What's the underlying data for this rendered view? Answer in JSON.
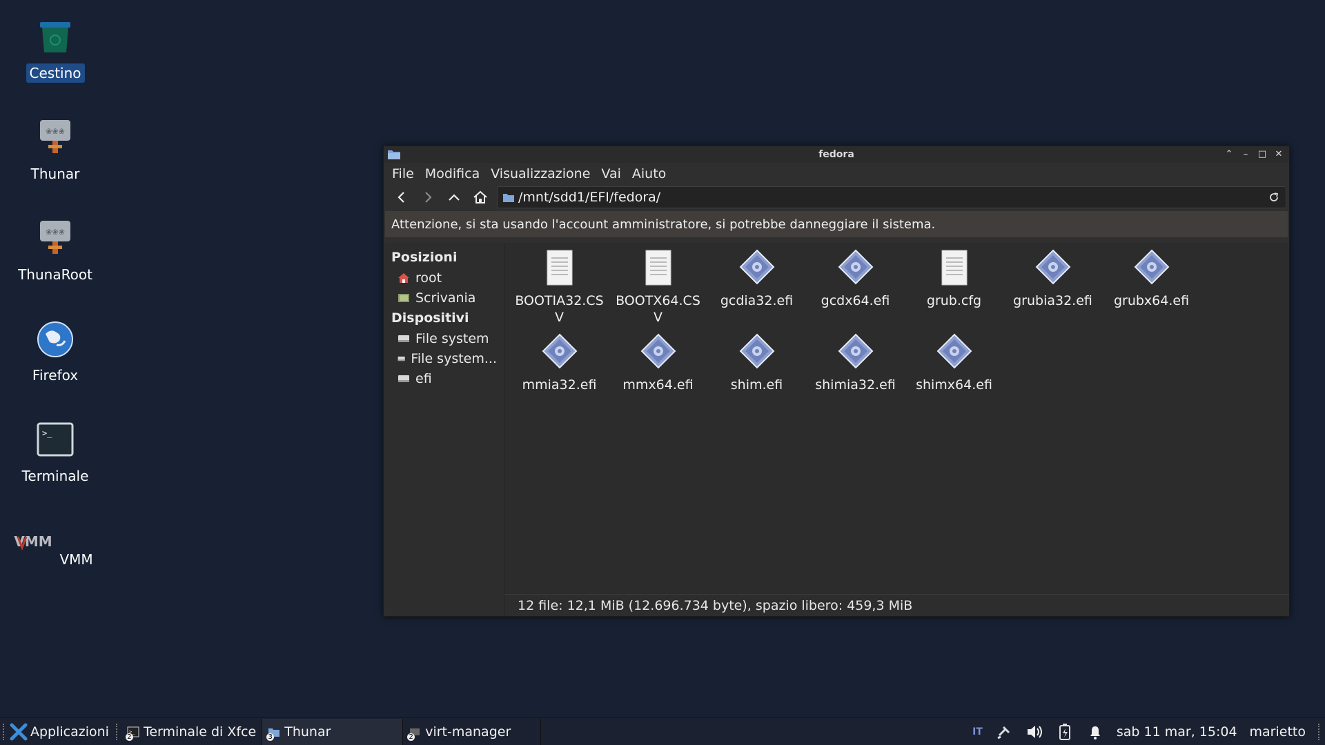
{
  "desktop": {
    "icons": [
      {
        "label": "Cestino",
        "icon": "trash-icon"
      },
      {
        "label": "Thunar",
        "icon": "file-manager-icon"
      },
      {
        "label": "ThunaRoot",
        "icon": "file-manager-root-icon"
      },
      {
        "label": "Firefox",
        "icon": "firefox-icon"
      },
      {
        "label": "Terminale",
        "icon": "terminal-icon"
      },
      {
        "label": "VMM",
        "icon": "vmm-icon"
      }
    ]
  },
  "window": {
    "title": "fedora",
    "menu": [
      "File",
      "Modifica",
      "Visualizzazione",
      "Vai",
      "Aiuto"
    ],
    "path": "/mnt/sdd1/EFI/fedora/",
    "warning": "Attenzione, si sta usando l'account amministratore, si potrebbe danneggiare il sistema.",
    "sidebar": {
      "places_header": "Posizioni",
      "places": [
        {
          "label": "root",
          "icon": "home-icon"
        },
        {
          "label": "Scrivania",
          "icon": "desktop-icon"
        }
      ],
      "devices_header": "Dispositivi",
      "devices": [
        {
          "label": "File system",
          "icon": "drive-icon"
        },
        {
          "label": "File system...",
          "icon": "drive-icon"
        },
        {
          "label": "efi",
          "icon": "drive-icon"
        }
      ]
    },
    "files": [
      {
        "name": "BOOTIA32.CSV",
        "type": "text"
      },
      {
        "name": "BOOTX64.CSV",
        "type": "text"
      },
      {
        "name": "gcdia32.efi",
        "type": "executable"
      },
      {
        "name": "gcdx64.efi",
        "type": "executable"
      },
      {
        "name": "grub.cfg",
        "type": "text"
      },
      {
        "name": "grubia32.efi",
        "type": "executable"
      },
      {
        "name": "grubx64.efi",
        "type": "executable"
      },
      {
        "name": "mmia32.efi",
        "type": "executable"
      },
      {
        "name": "mmx64.efi",
        "type": "executable"
      },
      {
        "name": "shim.efi",
        "type": "executable"
      },
      {
        "name": "shimia32.efi",
        "type": "executable"
      },
      {
        "name": "shimx64.efi",
        "type": "executable"
      }
    ],
    "status": "12 file: 12,1 MiB (12.696.734 byte), spazio libero: 459,3 MiB"
  },
  "taskbar": {
    "apps_label": "Applicazioni",
    "tasks": [
      {
        "label": "Terminale di Xfce",
        "badge": "2",
        "active": false
      },
      {
        "label": "Thunar",
        "badge": "3",
        "active": true
      },
      {
        "label": "virt-manager",
        "badge": "2",
        "active": false
      }
    ],
    "keyboard_layout": "IT",
    "clock": "sab 11 mar, 15:04",
    "user": "marietto"
  }
}
